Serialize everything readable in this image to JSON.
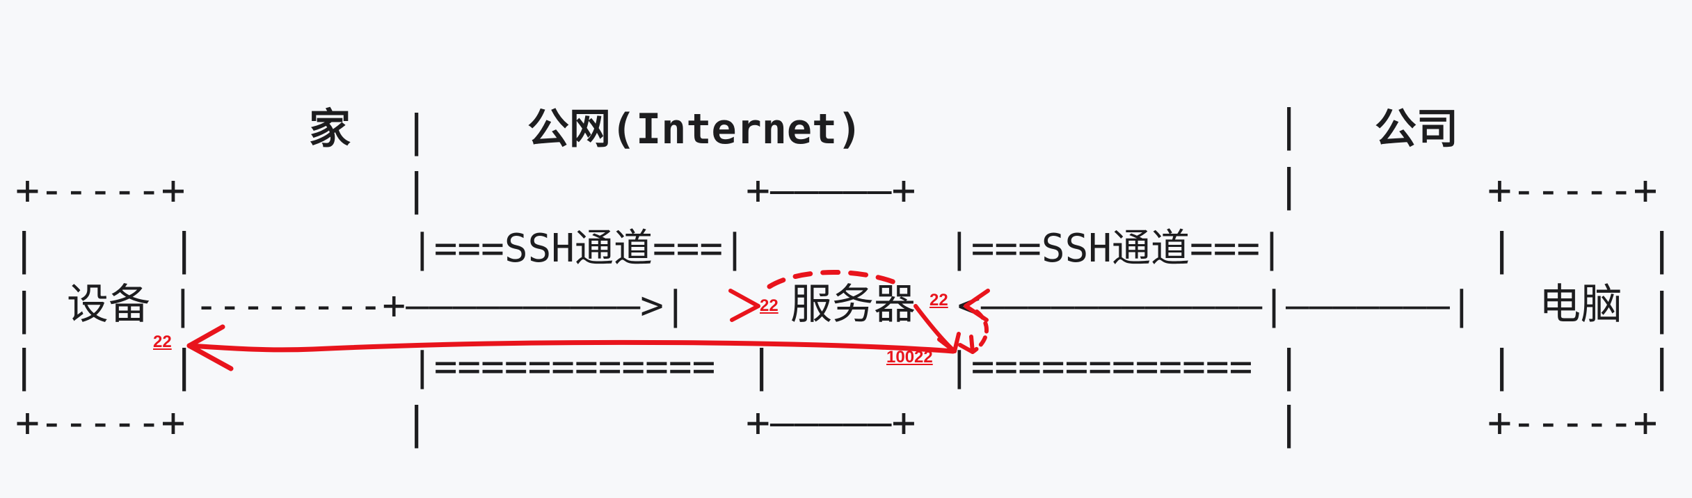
{
  "zones": {
    "home": "家",
    "internet": "公网(Internet)",
    "company": "公司"
  },
  "nodes": {
    "device": "设备",
    "server": "服务器",
    "computer": "电脑"
  },
  "ascii": {
    "box_edge": "+-----+",
    "server_edge": "+—————+",
    "pipe": "|",
    "tunnel_label_left": "|===SSH通道===|",
    "tunnel_label_right": "|===SSH通道===|",
    "tunnel_bottom_left": "|============",
    "tunnel_bottom_right": "|============",
    "link_left": "|--------+——————————>|",
    "link_right": "<————————————|———————|"
  },
  "annotations": {
    "port_device": "22",
    "port_server_in": "22",
    "port_server_right": "22",
    "port_forward": "10022",
    "color": "#e8141c"
  }
}
